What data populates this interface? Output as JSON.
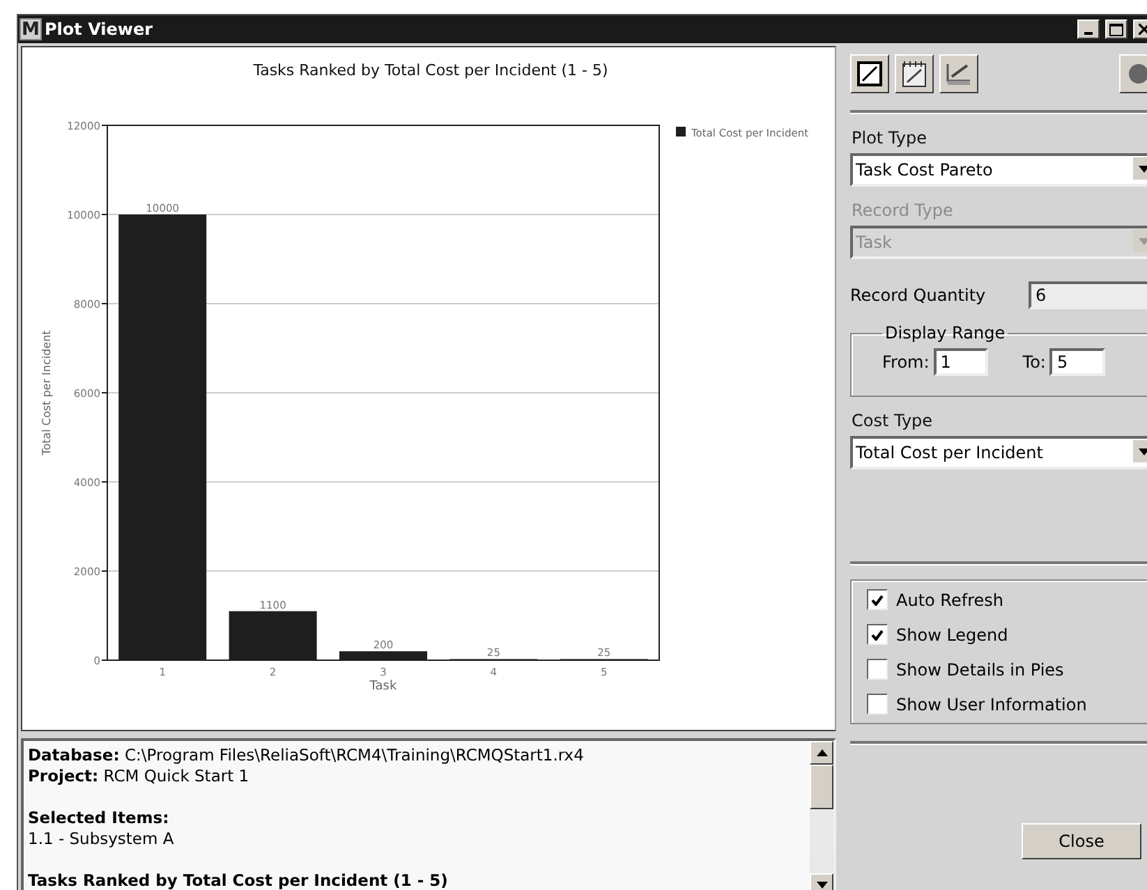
{
  "window": {
    "title": "Plot Viewer",
    "app_badge": "M"
  },
  "chart": {
    "chart_data": {
      "type": "bar",
      "title": "Tasks Ranked by Total Cost per Incident (1 - 5)",
      "xlabel": "Task",
      "ylabel": "Total Cost per Incident",
      "categories": [
        "1",
        "2",
        "3",
        "4",
        "5"
      ],
      "series": [
        {
          "name": "Total Cost per Incident",
          "color": "#1e1e1e",
          "values": [
            10000,
            1100,
            200,
            25,
            25
          ]
        }
      ],
      "ylim": [
        0,
        12000
      ],
      "yticks": [
        0,
        2000,
        4000,
        6000,
        8000,
        10000,
        12000
      ],
      "data_labels": true,
      "grid": true
    }
  },
  "info_panel": {
    "blocks": [
      {
        "lines": [
          "**Database:** C:\\Program Files\\ReliaSoft\\RCM4\\Training\\RCMQStart1.rx4",
          "**Project:** RCM Quick Start 1"
        ]
      },
      {
        "lines": [
          "**Selected Items:**",
          "1.1 - Subsystem A"
        ]
      },
      {
        "lines": [
          "**Tasks Ranked by Total Cost per Incident (1 - 5)**"
        ]
      }
    ]
  },
  "sidebar": {
    "plot_type": {
      "label": "Plot Type",
      "value": "Task Cost Pareto",
      "disabled": false
    },
    "record_type": {
      "label": "Record Type",
      "value": "Task",
      "disabled": true
    },
    "record_quantity": {
      "label": "Record Quantity",
      "value": "6"
    },
    "display_range": {
      "title": "Display Range",
      "from_label": "From:",
      "from_value": "1",
      "to_label": "To:",
      "to_value": "5"
    },
    "cost_type": {
      "label": "Cost Type",
      "value": "Total Cost per Incident",
      "disabled": false
    },
    "options": [
      {
        "label": "Auto Refresh",
        "checked": true
      },
      {
        "label": "Show Legend",
        "checked": true
      },
      {
        "label": "Show Details in Pies",
        "checked": false
      },
      {
        "label": "Show User Information",
        "checked": false
      }
    ],
    "close_button": "Close"
  }
}
